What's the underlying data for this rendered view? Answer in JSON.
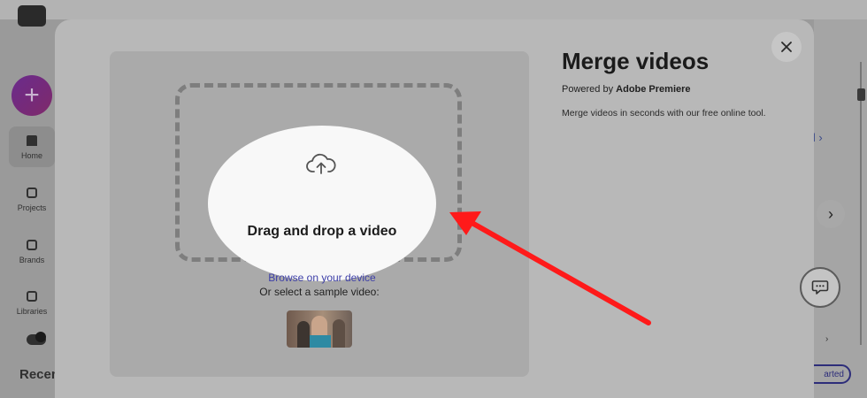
{
  "background": {
    "nav": [
      {
        "label": "Home"
      },
      {
        "label": "Projects"
      },
      {
        "label": "Brands"
      },
      {
        "label": "Libraries"
      }
    ],
    "create_symbol": "+",
    "bottom_heading_partial": "Recen",
    "view_all_partial": "ll ›",
    "get_started_partial": "arted",
    "next_symbol": "›"
  },
  "modal": {
    "title": "Merge videos",
    "powered_prefix": "Powered by ",
    "powered_brand": "Adobe Premiere",
    "description": "Merge videos in seconds with our free online tool.",
    "drop_title": "Drag and drop a video",
    "browse_link": "Browse on your device",
    "sample_label": "Or select a sample video:"
  },
  "icons": {
    "upload": "cloud-upload-icon",
    "close": "close-icon",
    "chat": "chat-icon"
  },
  "colors": {
    "annotation_arrow": "#ff1a1a",
    "link": "#3d3fa8"
  }
}
